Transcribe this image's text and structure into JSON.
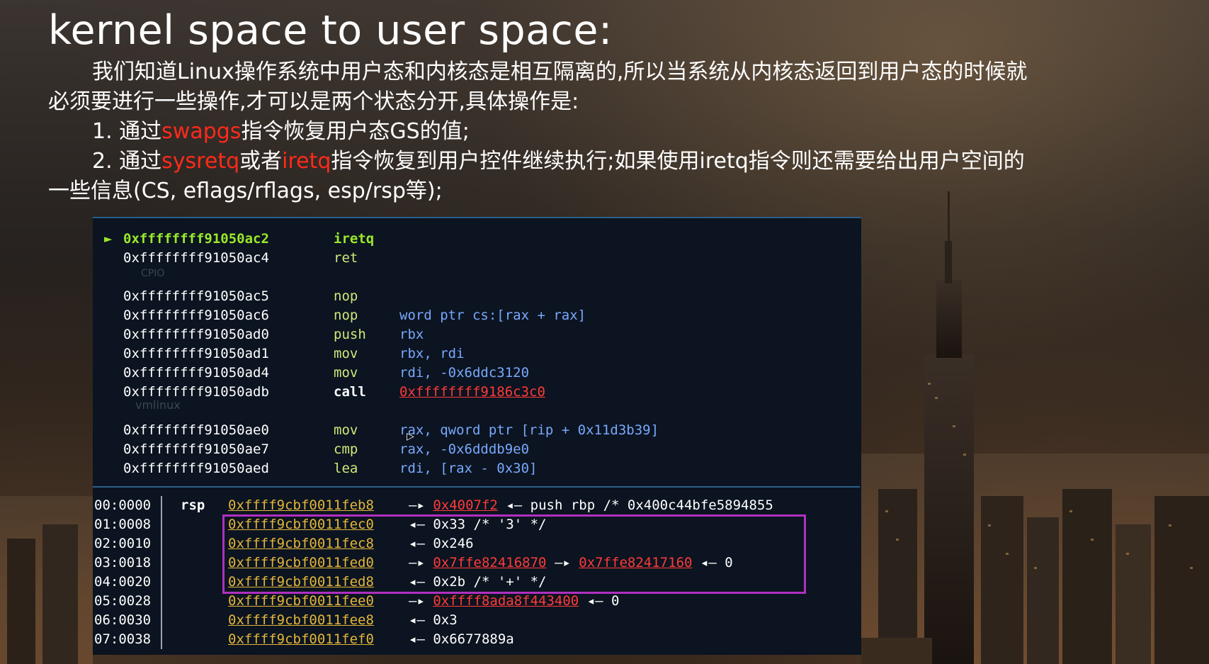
{
  "slide": {
    "title": "kernel space to user space:",
    "para1_line1": "我们知道Linux操作系统中用户态和内核态是相互隔离的,所以当系统从内核态返回到用户态的时候就",
    "para1_line2": "必须要进行一些操作,才可以是两个状态分开,具体操作是:",
    "item1_prefix": "1. 通过",
    "item1_keyword": "swapgs",
    "item1_suffix": "指令恢复用户态GS的值;",
    "item2_prefix": "2. 通过",
    "item2_keyword1": "sysretq",
    "item2_mid": "或者",
    "item2_keyword2": "iretq",
    "item2_suffix": "指令恢复到用户控件继续执行;如果使用iretq指令则还需要给出用户空间的",
    "item2_line2": "一些信息(CS, eflags/rflags, esp/rsp等);",
    "highlight_color": "#ff2a1a"
  },
  "terminal": {
    "current_marker": "►",
    "ghost_labels": [
      "CPIO",
      "vmlinux"
    ],
    "disasm": [
      {
        "addr": "0xffffffff91050ac2",
        "mnemonic": "iretq",
        "ops": ""
      },
      {
        "addr": "0xffffffff91050ac4",
        "mnemonic": "ret",
        "ops": ""
      },
      {
        "addr": "0xffffffff91050ac5",
        "mnemonic": "nop",
        "ops": ""
      },
      {
        "addr": "0xffffffff91050ac6",
        "mnemonic": "nop",
        "ops": "word ptr cs:[rax + rax]"
      },
      {
        "addr": "0xffffffff91050ad0",
        "mnemonic": "push",
        "ops": "rbx"
      },
      {
        "addr": "0xffffffff91050ad1",
        "mnemonic": "mov",
        "ops": "rbx, rdi"
      },
      {
        "addr": "0xffffffff91050ad4",
        "mnemonic": "mov",
        "ops": "rdi, -0x6ddc3120"
      },
      {
        "addr": "0xffffffff91050adb",
        "mnemonic": "call",
        "ops": "0xffffffff9186c3c0"
      },
      {
        "addr": "0xffffffff91050ae0",
        "mnemonic": "mov",
        "ops": "rax, qword ptr [rip + 0x11d3b39]"
      },
      {
        "addr": "0xffffffff91050ae7",
        "mnemonic": "cmp",
        "ops": "rax, -0x6dddb9e0"
      },
      {
        "addr": "0xffffffff91050aed",
        "mnemonic": "lea",
        "ops": "rdi, [rax - 0x30]"
      }
    ],
    "stack": [
      {
        "offset": "00:0000",
        "reg": "rsp",
        "addr": "0xffff9cbf0011feb8",
        "arrow": "—▸",
        "target": "0x4007f2",
        "tail": "◂— push    rbp /* 0x400c44bfe5894855"
      },
      {
        "offset": "01:0008",
        "reg": "",
        "addr": "0xffff9cbf0011fec0",
        "arrow": "◂—",
        "target": "",
        "tail": "0x33 /* '3' */"
      },
      {
        "offset": "02:0010",
        "reg": "",
        "addr": "0xffff9cbf0011fec8",
        "arrow": "◂—",
        "target": "",
        "tail": "0x246"
      },
      {
        "offset": "03:0018",
        "reg": "",
        "addr": "0xffff9cbf0011fed0",
        "arrow": "—▸",
        "target": "0x7ffe82416870",
        "target2": "0x7ffe82417160",
        "tail": "◂— 0"
      },
      {
        "offset": "04:0020",
        "reg": "",
        "addr": "0xffff9cbf0011fed8",
        "arrow": "◂—",
        "target": "",
        "tail": "0x2b /* '+' */"
      },
      {
        "offset": "05:0028",
        "reg": "",
        "addr": "0xffff9cbf0011fee0",
        "arrow": "—▸",
        "target": "0xffff8ada8f443400",
        "tail": "◂— 0"
      },
      {
        "offset": "06:0030",
        "reg": "",
        "addr": "0xffff9cbf0011fee8",
        "arrow": "◂—",
        "target": "",
        "tail": "0x3"
      },
      {
        "offset": "07:0038",
        "reg": "",
        "addr": "0xffff9cbf0011fef0",
        "arrow": "◂—",
        "target": "",
        "tail": "0x6677889a"
      }
    ],
    "colors": {
      "current": "#9be82a",
      "address_link": "#e4b53a",
      "pointer": "#ff3a3a",
      "register": "#7aa8ff",
      "highlight_box": "#b030c0"
    }
  }
}
